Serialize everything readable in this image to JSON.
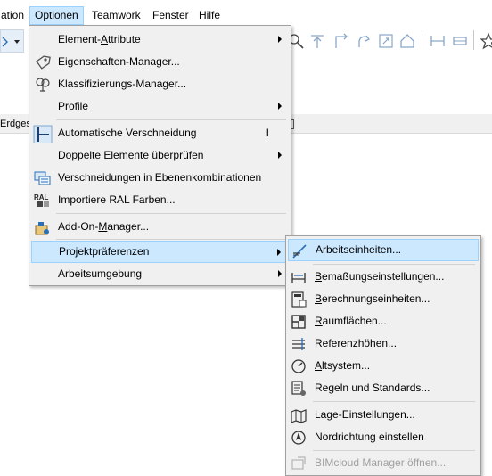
{
  "menubar": {
    "items": [
      {
        "label": "ation"
      },
      {
        "label": "Optionen"
      },
      {
        "label": "Teamwork"
      },
      {
        "label": "Fenster"
      },
      {
        "label": "Hilfe"
      }
    ]
  },
  "tabstrip": {
    "label": "Erdges"
  },
  "menu": {
    "items": [
      {
        "label": "Element-Attribute",
        "has_submenu": true,
        "icon": ""
      },
      {
        "label": "Eigenschaften-Manager...",
        "icon": "tag-icon"
      },
      {
        "label": "Klassifizierungs-Manager...",
        "icon": "tree-icon"
      },
      {
        "label": "Profile",
        "has_submenu": true,
        "icon": ""
      },
      {
        "label": "Automatische Verschneidung",
        "shortcut": "I",
        "icon": "auto-intersection-icon"
      },
      {
        "label": "Doppelte Elemente überprüfen",
        "has_submenu": true,
        "icon": ""
      },
      {
        "label": "Verschneidungen in Ebenenkombinationen",
        "icon": "layer-intersection-icon"
      },
      {
        "label": "Importiere RAL Farben...",
        "icon": "ral-icon",
        "icon_text": "RAL"
      },
      {
        "label": "Add-On-Manager...",
        "icon": "addon-icon"
      },
      {
        "label": "Projektpräferenzen",
        "has_submenu": true,
        "highlighted": true,
        "icon": ""
      },
      {
        "label": "Arbeitsumgebung",
        "has_submenu": true,
        "icon": ""
      }
    ]
  },
  "submenu": {
    "items": [
      {
        "label": "Arbeitseinheiten...",
        "highlighted": true,
        "icon": "ruler-pencil-icon"
      },
      {
        "label": "Bemaßungseinstellungen...",
        "icon": "dimension-icon"
      },
      {
        "label": "Berechnungseinheiten...",
        "icon": "calculator-icon"
      },
      {
        "label": "Raumflächen...",
        "icon": "room-area-icon"
      },
      {
        "label": "Referenzhöhen...",
        "icon": "reference-levels-icon"
      },
      {
        "label": "Altsystem...",
        "icon": "legacy-gauge-icon"
      },
      {
        "label": "Regeln und Standards...",
        "icon": "rules-standards-icon"
      },
      {
        "label": "Lage-Einstellungen...",
        "icon": "location-map-icon"
      },
      {
        "label": "Nordrichtung einstellen",
        "icon": "compass-icon"
      },
      {
        "label": "BIMcloud Manager öffnen...",
        "disabled": true,
        "icon": "bimcloud-icon"
      }
    ]
  },
  "colors": {
    "menu_bg": "#f0f0f0",
    "highlight_bg": "#cce8ff",
    "highlight_border": "#99d1ff",
    "disabled_text": "#a0a0a0",
    "accent_blue": "#2a6fb8"
  }
}
